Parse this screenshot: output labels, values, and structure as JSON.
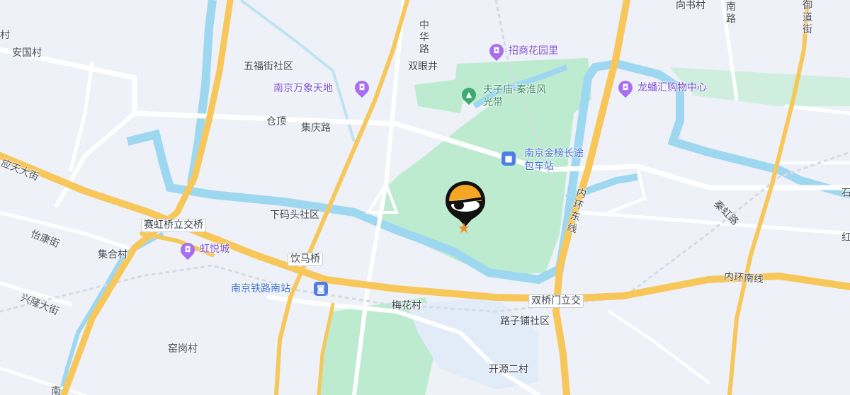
{
  "map": {
    "colors": {
      "background": "#eef1f8",
      "water": "#9ed7f0",
      "green": "#bdebd0",
      "highway": "#f8c75a",
      "road": "#ffffff",
      "poi": "#8a5cf0",
      "accent": "#4f7de6"
    },
    "road_labels": {
      "zhonghua_road": "中华路",
      "jiqing_road": "集庆路",
      "yingtian_street": "应天大街",
      "yikang_street": "怡康街",
      "xinglong_street": "兴隆大街",
      "inner_ring_east": "内环东线",
      "inner_ring_south": "内环南线",
      "yudao_street": "御道街",
      "qinhong_road": "秦虹路",
      "nan_road": "南路",
      "right_edge_a": "石",
      "right_edge_b": "红",
      "bottom_left_a": "南",
      "top_left_a": "村"
    },
    "places": {
      "anguo": "安国村",
      "wufu": "五福街社区",
      "shuangyanjing": "双眼井",
      "cangding": "仓顶",
      "xiamatou": "下码头社区",
      "jihe": "集合村",
      "yaogang": "窑岗村",
      "meihua": "梅花村",
      "luzipu": "路子铺社区",
      "kaiyuan": "开源二村",
      "xiangshu": "向书村"
    },
    "pois": {
      "wanxiang": "南京万象天地",
      "zhaoshang": "招商花园里",
      "fuzimiao": "夫子庙-秦淮风光带",
      "longfan": "龙蟠汇购物中心",
      "jinbang": "南京金榜长途包车站",
      "hongyue": "虹悦城",
      "nanzhan": "南京铁路南站"
    },
    "badges": {
      "saihong": "赛虹桥立交桥",
      "yinma": "饮马桥",
      "shuangqiao": "双桥门立交"
    },
    "marker": {
      "icon": "location-pin-icon",
      "star": "★"
    }
  }
}
